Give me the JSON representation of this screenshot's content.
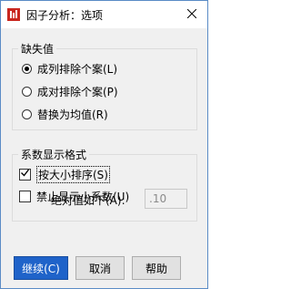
{
  "window": {
    "title": "因子分析：选项",
    "accent_color": "#1f63c9"
  },
  "missing_values": {
    "caption": "缺失值",
    "options": [
      {
        "label": "成列排除个案(L)",
        "selected": true
      },
      {
        "label": "成对排除个案(P)",
        "selected": false
      },
      {
        "label": "替换为均值(R)",
        "selected": false
      }
    ]
  },
  "coefficient_display": {
    "caption": "系数显示格式",
    "sort_by_size": {
      "label": "按大小排序(S)",
      "checked": true
    },
    "suppress_small": {
      "label": "禁止显示小系数(U)",
      "checked": false
    },
    "absolute_value_below": {
      "label": "绝对值如下(A):",
      "value": ".10"
    }
  },
  "buttons": {
    "continue": "继续(C)",
    "cancel": "取消",
    "help": "帮助"
  }
}
